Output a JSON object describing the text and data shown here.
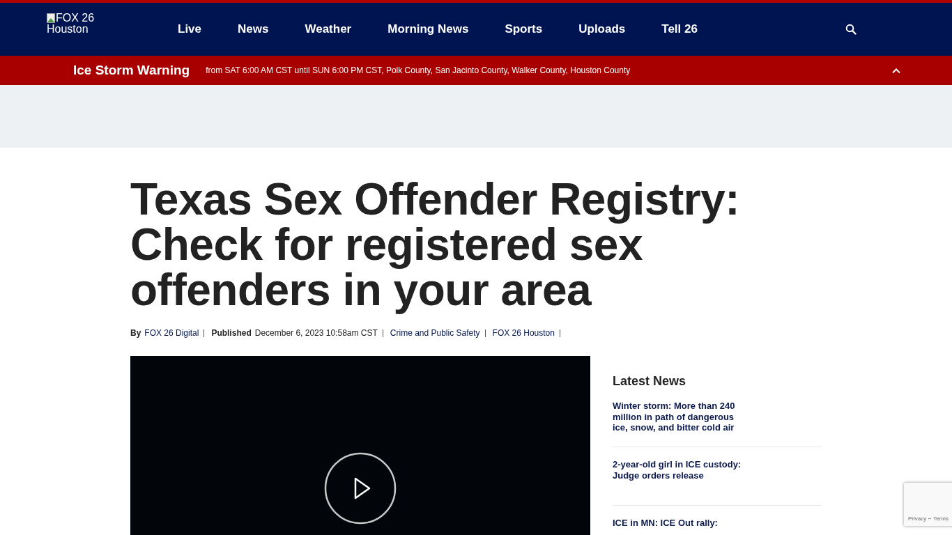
{
  "logo": {
    "alt": "FOX 26 Houston"
  },
  "nav": [
    "Live",
    "News",
    "Weather",
    "Morning News",
    "Sports",
    "Uploads",
    "Tell 26"
  ],
  "alert": {
    "title": "Ice Storm Warning",
    "text": "from SAT 6:00 AM CST until SUN 6:00 PM CST, Polk County, San Jacinto County, Walker County, Houston County",
    "expanded": true
  },
  "article": {
    "title": "Texas Sex Offender Registry: Check for registered sex offenders in your area",
    "meta": {
      "by_label": "By",
      "author": "FOX 26 Digital",
      "published_label": "Published",
      "date": "December 6, 2023 10:58am CST",
      "category": "Crime and Public Safety",
      "source": "FOX 26 Houston"
    }
  },
  "latest_news": {
    "heading": "Latest News",
    "items": [
      {
        "title": "Winter storm: More than 240 million in path of dangerous ice, snow, and bitter cold air"
      },
      {
        "title": "2-year-old girl in ICE custody: Judge orders release"
      },
      {
        "title": "ICE in MN: ICE Out rally:"
      }
    ]
  },
  "recaptcha": {
    "links": [
      "Privacy",
      "Terms"
    ]
  }
}
